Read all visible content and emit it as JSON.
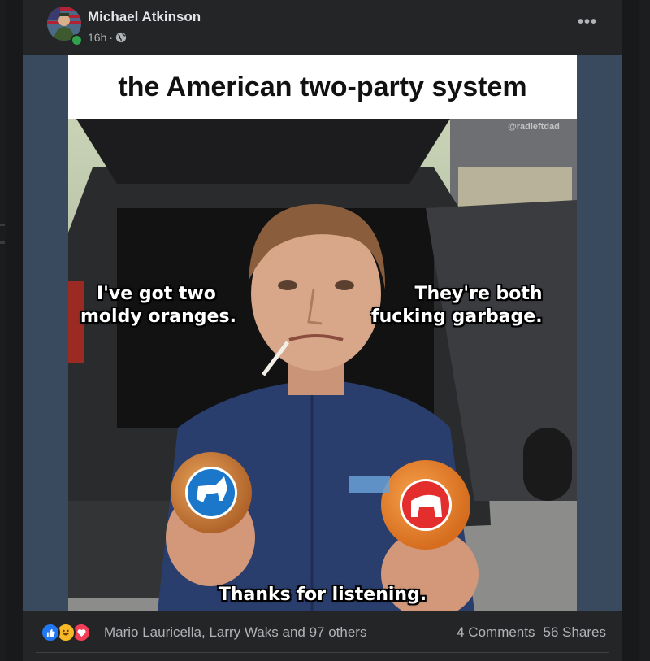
{
  "post": {
    "author": "Michael Atkinson",
    "time": "16h",
    "separator": "·",
    "more_label": "•••"
  },
  "meme": {
    "title": "the American two-party system",
    "watermark": "@radleftdad",
    "caption_left_1": "I've got two",
    "caption_left_2": "moldy oranges.",
    "caption_right_1": "They're both",
    "caption_right_2": "fucking garbage.",
    "caption_bottom": "Thanks for listening."
  },
  "footer": {
    "reaction_icons": [
      "like-icon",
      "haha-icon",
      "love-icon"
    ],
    "reaction_names": "Mario Lauricella, Larry Waks and 97 others",
    "comments": "4 Comments",
    "shares": "56 Shares"
  },
  "colors": {
    "background": "#18191a",
    "card": "#242526",
    "text_primary": "#e4e6eb",
    "text_secondary": "#b0b3b8",
    "like": "#2078f4",
    "love": "#f33e58",
    "haha": "#f7b928",
    "online": "#31a24c"
  }
}
